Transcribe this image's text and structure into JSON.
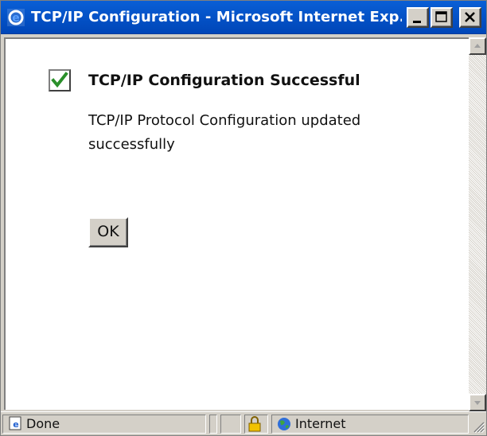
{
  "window": {
    "title": "TCP/IP Configuration - Microsoft Internet Exp...",
    "controls": {
      "minimize": "minimize",
      "maximize": "maximize",
      "close": "close"
    }
  },
  "content": {
    "heading": "TCP/IP Configuration Successful",
    "message": "TCP/IP Protocol Configuration updated successfully",
    "ok_label": "OK"
  },
  "statusbar": {
    "status_text": "Done",
    "zone_text": "Internet"
  },
  "icons": {
    "title": "internet-explorer-icon",
    "check": "checkmark-icon",
    "lock": "padlock-icon",
    "zone": "globe-icon"
  },
  "colors": {
    "titlebar": "#0453c8",
    "chrome": "#d4d0c8",
    "check_green": "#2a8f2a"
  }
}
